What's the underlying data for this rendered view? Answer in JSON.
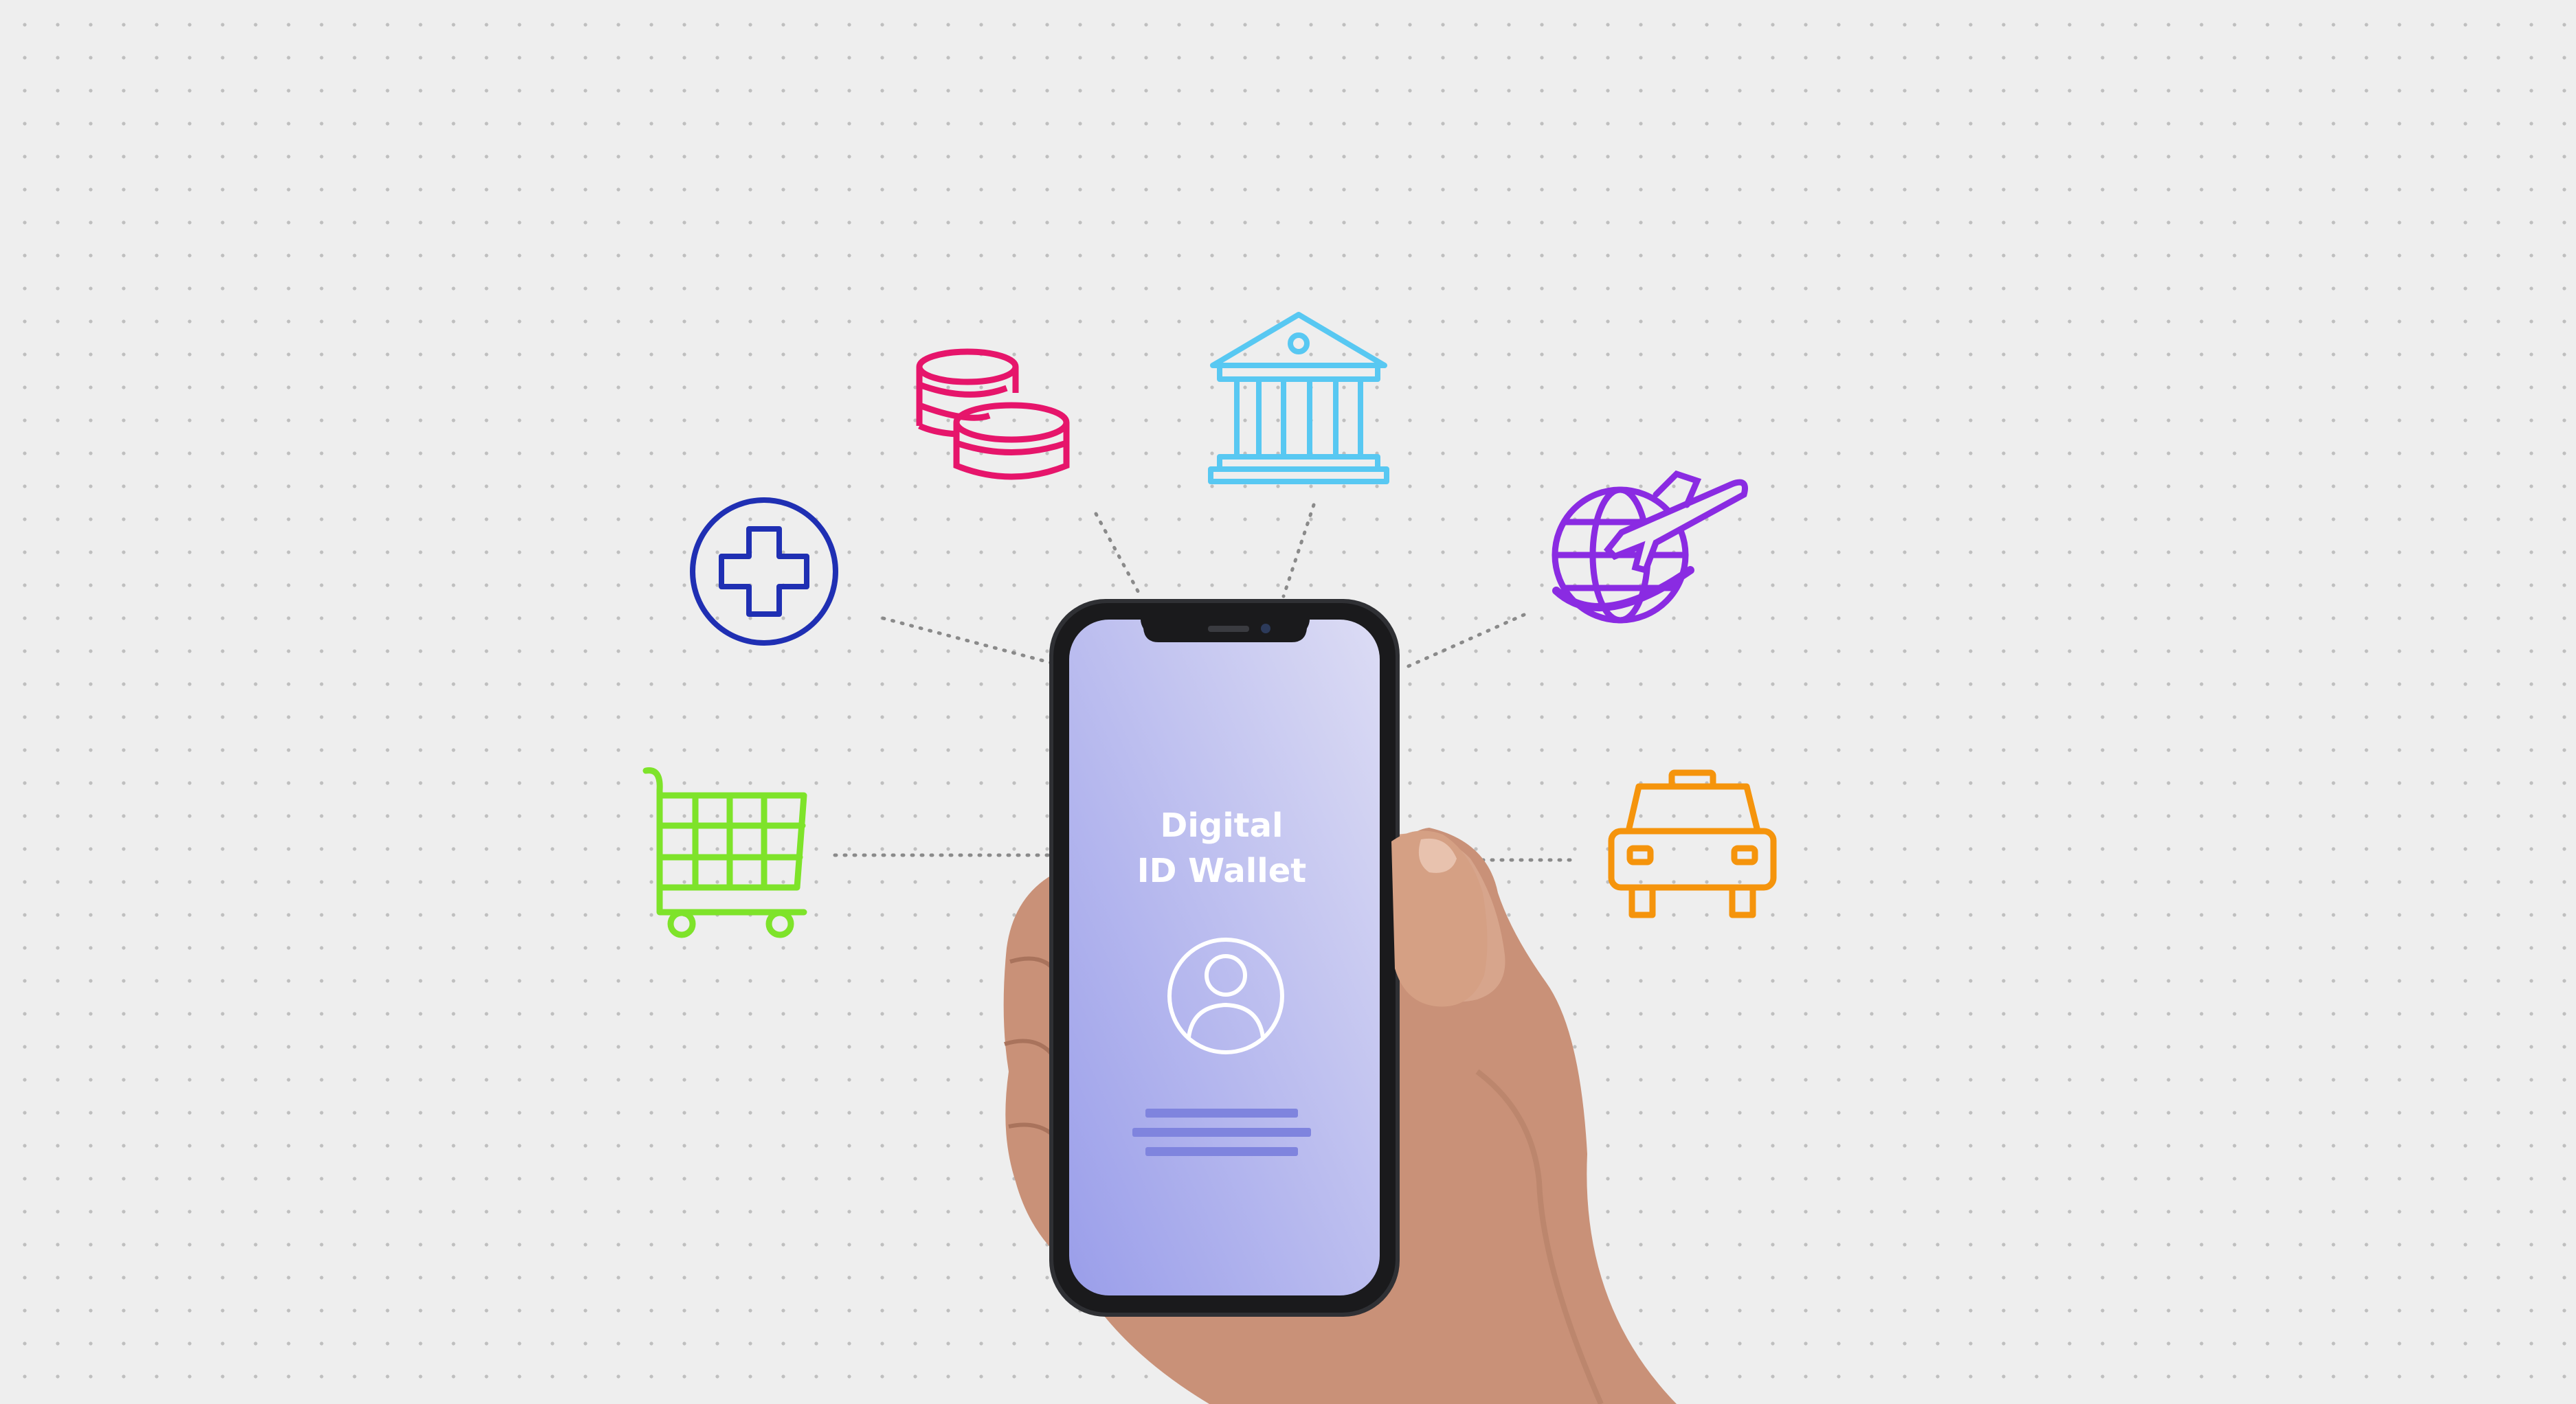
{
  "phone": {
    "title_line1": "Digital",
    "title_line2": "ID Wallet",
    "screen_gradient": [
      "#dcdcf4",
      "#9a9eea"
    ],
    "accent_lines_color": "#7f84de"
  },
  "icons": [
    {
      "name": "medical-cross-icon",
      "color": "#1f2fb3"
    },
    {
      "name": "coins-icon",
      "color": "#e6156b"
    },
    {
      "name": "bank-icon",
      "color": "#58c8f2"
    },
    {
      "name": "travel-globe-plane-icon",
      "color": "#8a2be2"
    },
    {
      "name": "shopping-cart-icon",
      "color": "#7ee32a"
    },
    {
      "name": "taxi-icon",
      "color": "#f5940c"
    }
  ],
  "connector_color": "#8a8a8a"
}
